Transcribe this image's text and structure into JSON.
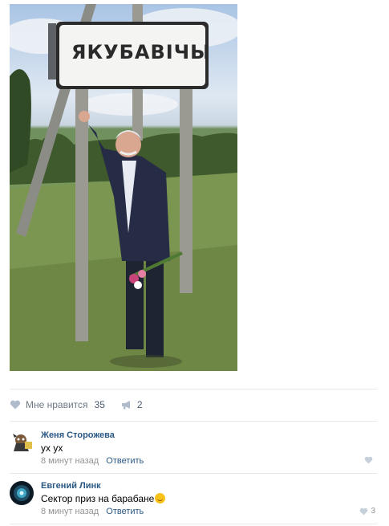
{
  "post": {
    "sign_text": "ЯКУБАВІЧЫ",
    "likes_label": "Мне нравится",
    "likes_count": "35",
    "shares_count": "2"
  },
  "comments": [
    {
      "author": "Женя Сторожева",
      "text": "ух ух",
      "time": "8 минут назад",
      "reply": "Ответить",
      "likes": ""
    },
    {
      "author": "Евгений Линк",
      "text": "Сектор приз на барабане",
      "time": "8 минут назад",
      "reply": "Ответить",
      "likes": "3"
    }
  ],
  "icons": {
    "like": "heart-icon",
    "share": "megaphone-icon",
    "comment_like": "heart-icon"
  },
  "colors": {
    "link": "#2a5885",
    "meta": "#939393",
    "divider": "#e7e8ec"
  }
}
